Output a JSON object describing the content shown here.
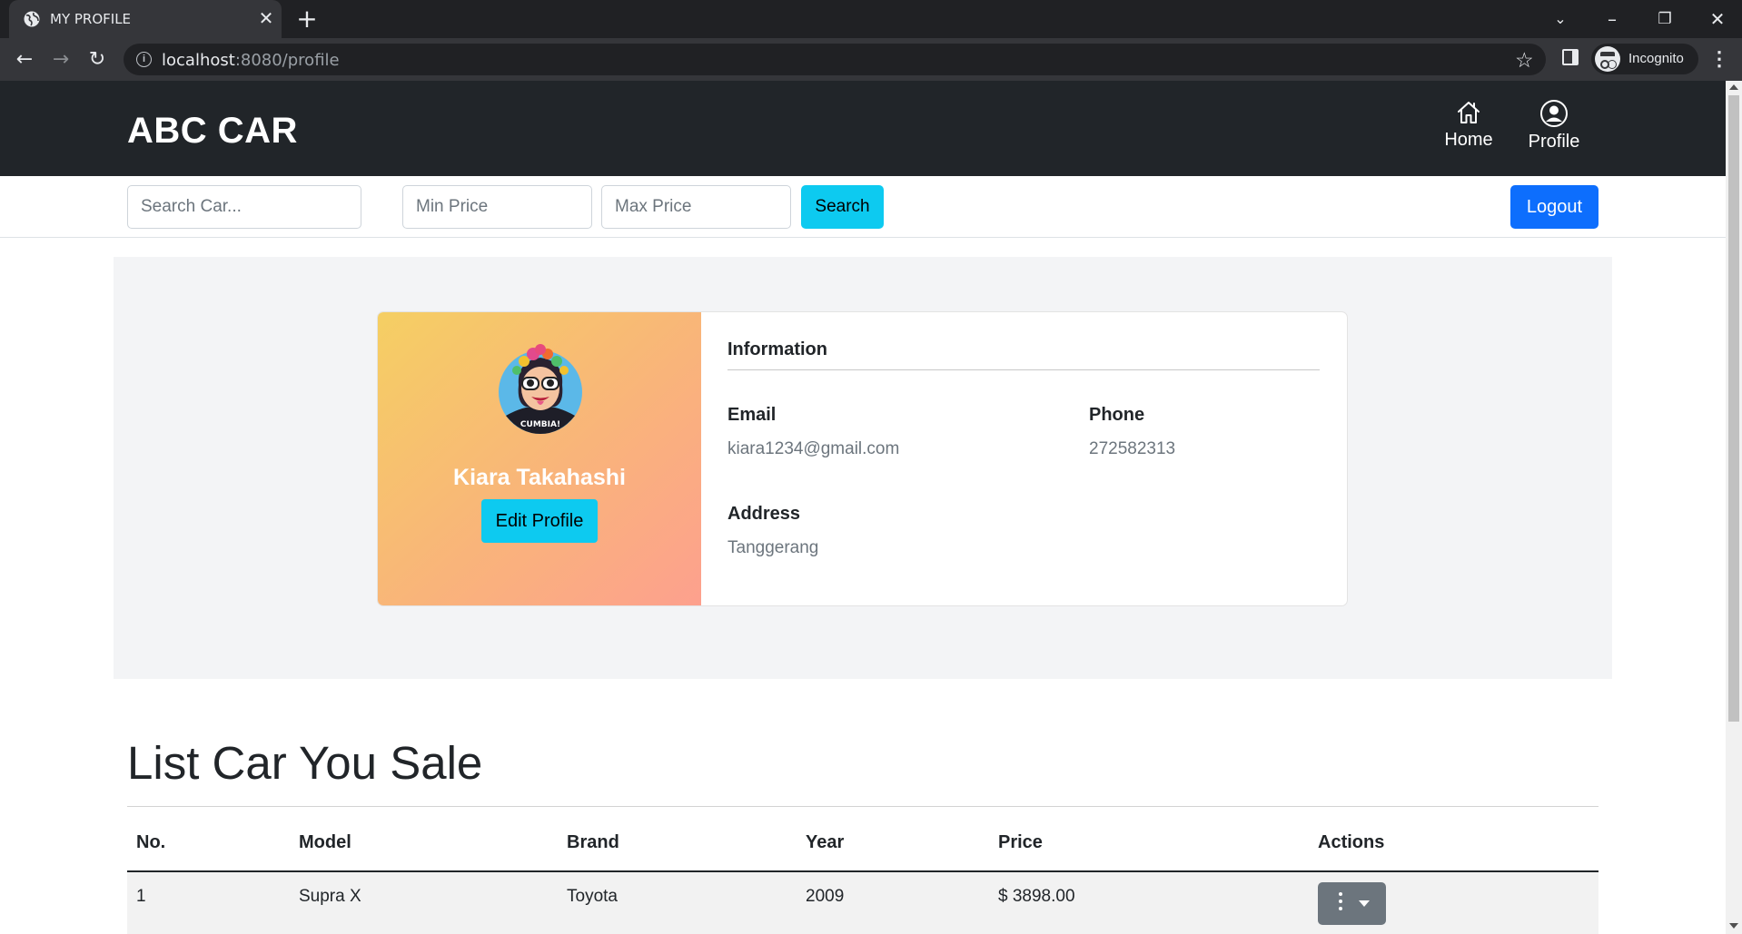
{
  "browser": {
    "tab_title": "MY PROFILE",
    "url_host": "localhost",
    "url_path": ":8080/profile",
    "incognito_label": "Incognito"
  },
  "navbar": {
    "brand": "ABC CAR",
    "home_label": "Home",
    "profile_label": "Profile"
  },
  "search": {
    "car_placeholder": "Search Car...",
    "min_placeholder": "Min Price",
    "max_placeholder": "Max Price",
    "search_label": "Search",
    "logout_label": "Logout"
  },
  "profile": {
    "name": "Kiara Takahashi",
    "edit_label": "Edit Profile",
    "info_title": "Information",
    "email_label": "Email",
    "email": "kiara1234@gmail.com",
    "phone_label": "Phone",
    "phone": "272582313",
    "address_label": "Address",
    "address": "Tanggerang",
    "avatar_text": "CUMBIA!"
  },
  "cars": {
    "title": "List Car You Sale",
    "columns": [
      "No.",
      "Model",
      "Brand",
      "Year",
      "Price",
      "Actions"
    ],
    "rows": [
      {
        "no": "1",
        "model": "Supra X",
        "brand": "Toyota",
        "year": "2009",
        "price": "$ 3898.00"
      }
    ]
  },
  "colors": {
    "navbar_bg": "#212529",
    "info_button": "#0dcaf0",
    "primary_button": "#0d6efd",
    "secondary_button": "#6c757d"
  }
}
